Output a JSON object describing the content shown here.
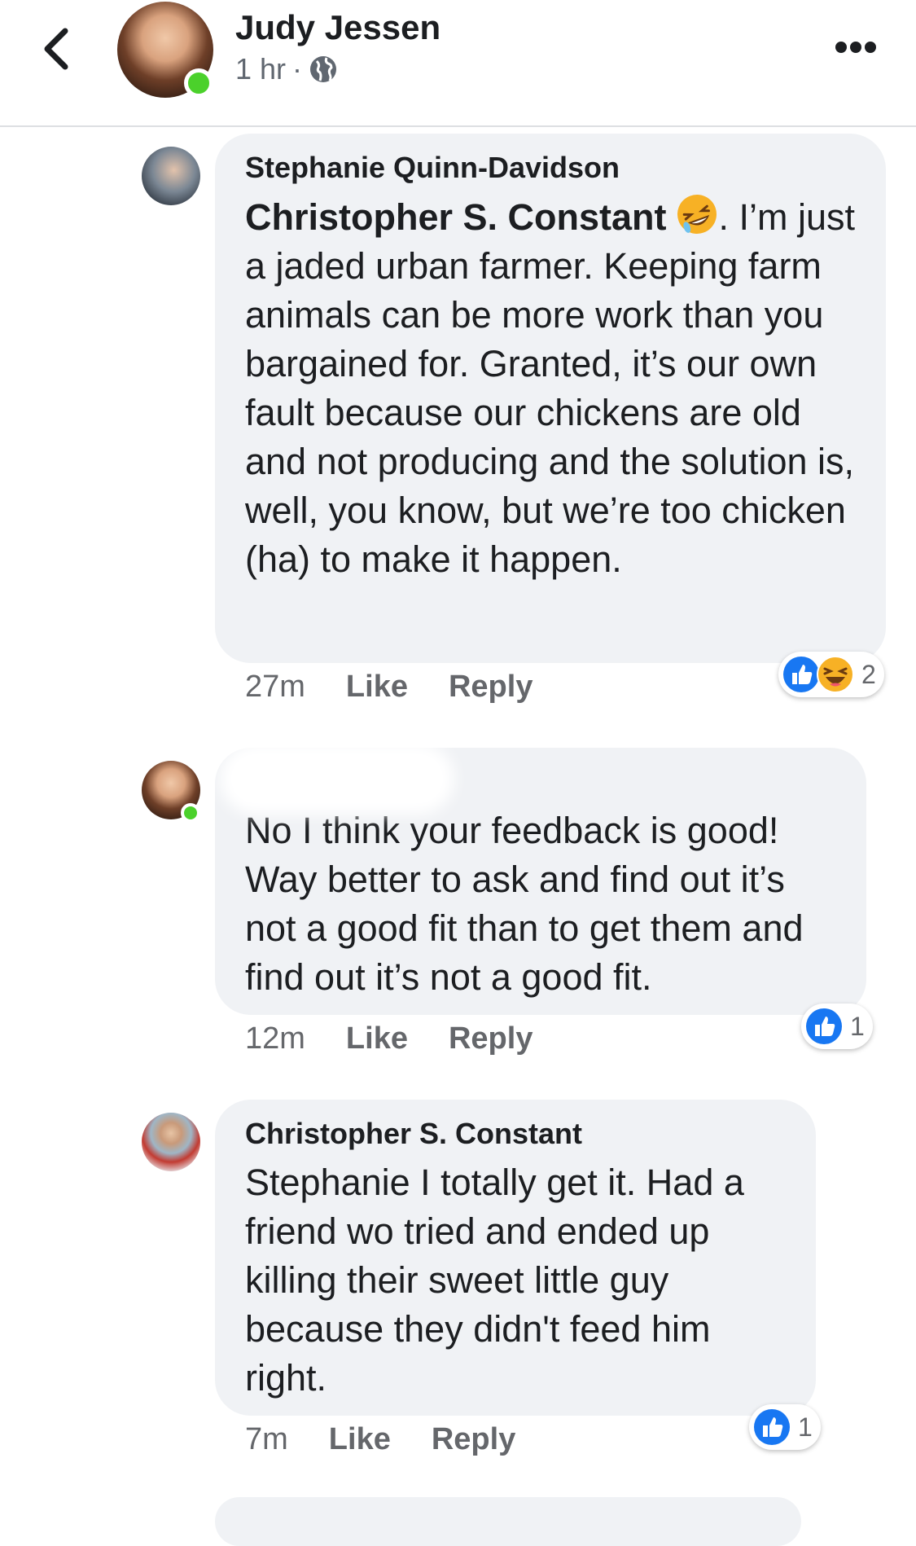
{
  "header": {
    "name": "Judy Jessen",
    "time": "1 hr",
    "separator": "·",
    "icons": {
      "back": "chevron-left-icon",
      "privacy": "globe-icon",
      "more": "more-icon"
    },
    "online": true
  },
  "comments": [
    {
      "author": "Stephanie Quinn-Davidson",
      "mention": "Christopher S. Constant",
      "emoji": "rofl-emoji",
      "body": ". I’m just a jaded urban farmer. Keeping farm animals can be more work than you bargained for. Granted, it’s our own fault because our chickens are old and not producing and the solution is, well, you know, but we’re too chicken (ha) to make it happen.",
      "time": "27m",
      "like": "Like",
      "reply": "Reply",
      "reactions": {
        "types": [
          "like",
          "haha"
        ],
        "count": "2"
      }
    },
    {
      "author": "",
      "author_redacted": true,
      "online": true,
      "body": "No I think your feedback is good! Way better to ask and find out it’s not a good fit than to get them and find out it’s not a good fit.",
      "time": "12m",
      "like": "Like",
      "reply": "Reply",
      "reactions": {
        "types": [
          "like"
        ],
        "count": "1"
      }
    },
    {
      "author": "Christopher S. Constant",
      "body": "Stephanie I totally get it. Had a friend wo tried and ended up killing their sweet little guy because they didn't feed him right.",
      "time": "7m",
      "like": "Like",
      "reply": "Reply",
      "reactions": {
        "types": [
          "like"
        ],
        "count": "1"
      }
    }
  ],
  "colors": {
    "bubble": "#f0f2f5",
    "like_blue": "#1877f2",
    "online_green": "#4bd12b",
    "meta_gray": "#65676b",
    "haha_yellow": "#f7b125"
  }
}
